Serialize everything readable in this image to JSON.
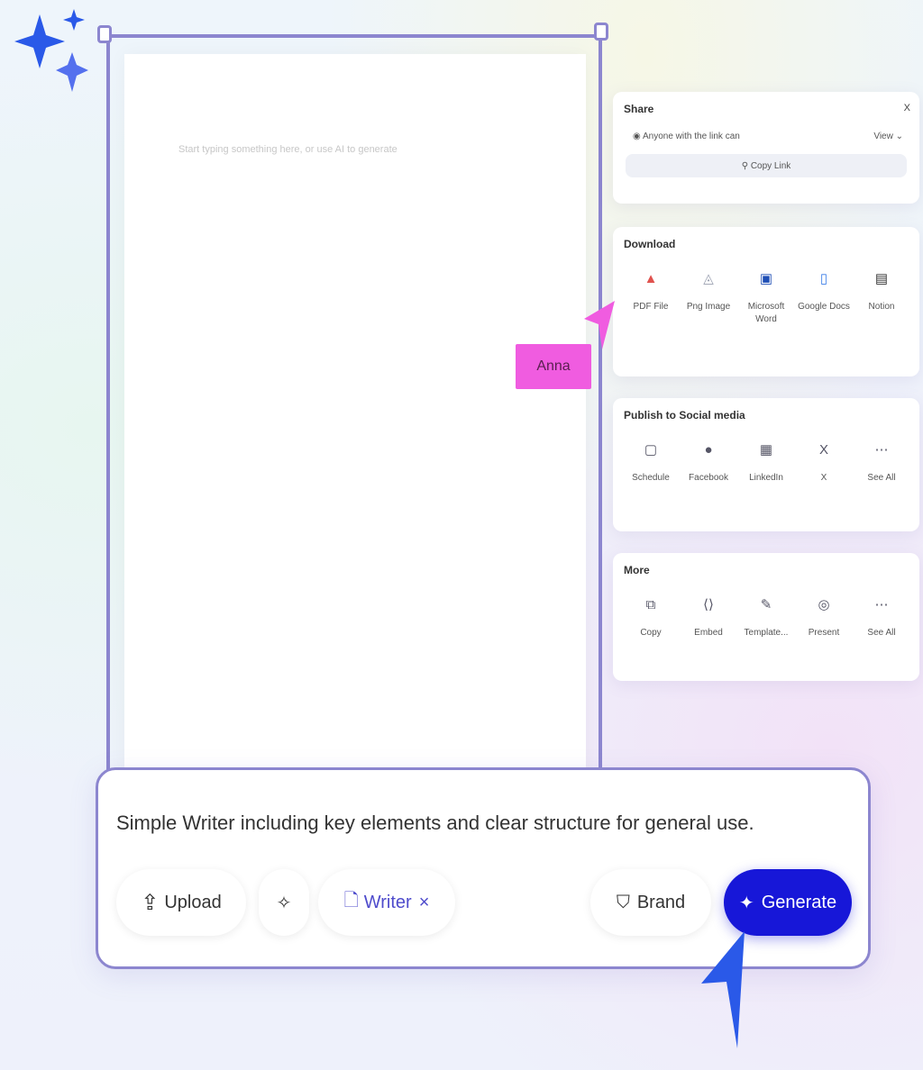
{
  "document": {
    "placeholder": "Start typing something here, or use AI to generate"
  },
  "share": {
    "title": "Share",
    "close_label": "X",
    "access_text": "Anyone with the link can",
    "access_value": "View",
    "copy_link_label": "Copy Link"
  },
  "download": {
    "title": "Download",
    "items": [
      {
        "icon": "pdf-icon",
        "label": "PDF File",
        "color": "#e0524e"
      },
      {
        "icon": "image-icon",
        "label": "Png Image",
        "color": "#9aa0b0"
      },
      {
        "icon": "word-icon",
        "label": "Microsoft Word",
        "color": "#1f4fb5"
      },
      {
        "icon": "google-docs-icon",
        "label": "Google Docs",
        "color": "#3b7de8"
      },
      {
        "icon": "notion-icon",
        "label": "Notion",
        "color": "#333333"
      }
    ]
  },
  "social": {
    "title": "Publish to Social media",
    "items": [
      {
        "icon": "schedule-icon",
        "label": "Schedule"
      },
      {
        "icon": "facebook-icon",
        "label": "Facebook"
      },
      {
        "icon": "linkedin-icon",
        "label": "LinkedIn"
      },
      {
        "icon": "x-icon",
        "label": "X"
      },
      {
        "icon": "more-icon",
        "label": "See All"
      }
    ]
  },
  "more": {
    "title": "More",
    "items": [
      {
        "icon": "copy-icon",
        "label": "Copy"
      },
      {
        "icon": "embed-icon",
        "label": "Embed"
      },
      {
        "icon": "template-icon",
        "label": "Template..."
      },
      {
        "icon": "present-icon",
        "label": "Present"
      },
      {
        "icon": "more-icon",
        "label": "See All"
      }
    ]
  },
  "cursor_label": "Anna",
  "prompt": {
    "text": "Simple Writer including key elements and clear structure for general use.",
    "upload_label": "Upload",
    "writer_label": "Writer",
    "brand_label": "Brand",
    "generate_label": "Generate"
  },
  "colors": {
    "accent": "#1717d8",
    "frame": "#8c86cf",
    "cursor_tag": "#f05ce0"
  }
}
